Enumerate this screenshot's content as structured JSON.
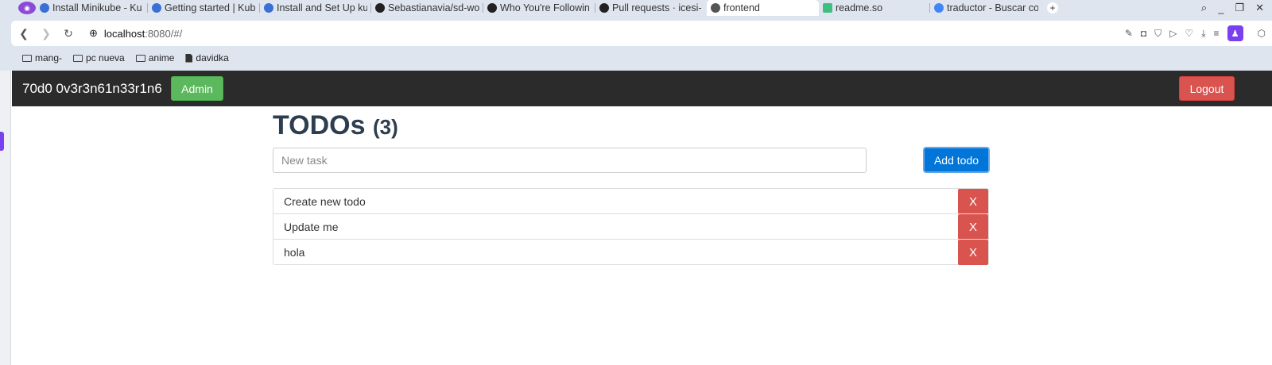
{
  "browser": {
    "tabs": [
      {
        "title": "Install Minikube - Ku",
        "favicon_color": "#3b6fd8",
        "active": false
      },
      {
        "title": "Getting started | Kub",
        "favicon_color": "#3b6fd8",
        "active": false
      },
      {
        "title": "Install and Set Up ku",
        "favicon_color": "#3b6fd8",
        "active": false
      },
      {
        "title": "Sebastianavia/sd-wo",
        "favicon_color": "#222222",
        "active": false
      },
      {
        "title": "Who You're Followin",
        "favicon_color": "#222222",
        "active": false
      },
      {
        "title": "Pull requests · icesi-",
        "favicon_color": "#222222",
        "active": false
      },
      {
        "title": "frontend",
        "favicon_color": "#555555",
        "active": true
      },
      {
        "title": "readme.so",
        "favicon_color": "#3fbf7f",
        "active": false
      },
      {
        "title": "traductor - Buscar co",
        "favicon_color": "#4285f4",
        "active": false
      }
    ],
    "new_tab_label": "+",
    "url": {
      "host": "localhost",
      "rest": ":8080/#/"
    },
    "bookmarks": [
      {
        "label": "mang-",
        "type": "folder"
      },
      {
        "label": "pc nueva",
        "type": "folder"
      },
      {
        "label": "anime",
        "type": "folder"
      },
      {
        "label": "davidka",
        "type": "file"
      }
    ]
  },
  "app": {
    "brand": "70d0 0v3r3n61n33r1n6",
    "admin_label": "Admin",
    "logout_label": "Logout",
    "title": "TODOs",
    "count": "(3)",
    "input_placeholder": "New task",
    "add_label": "Add todo",
    "todos": [
      {
        "text": "Create new todo",
        "delete_label": "X"
      },
      {
        "text": "Update me",
        "delete_label": "X"
      },
      {
        "text": "hola",
        "delete_label": "X"
      }
    ]
  },
  "colors": {
    "navbar": "#2b2b2b",
    "success": "#5cb85c",
    "danger": "#d9534f",
    "primary": "#0275d8",
    "heading": "#2c3e50"
  }
}
